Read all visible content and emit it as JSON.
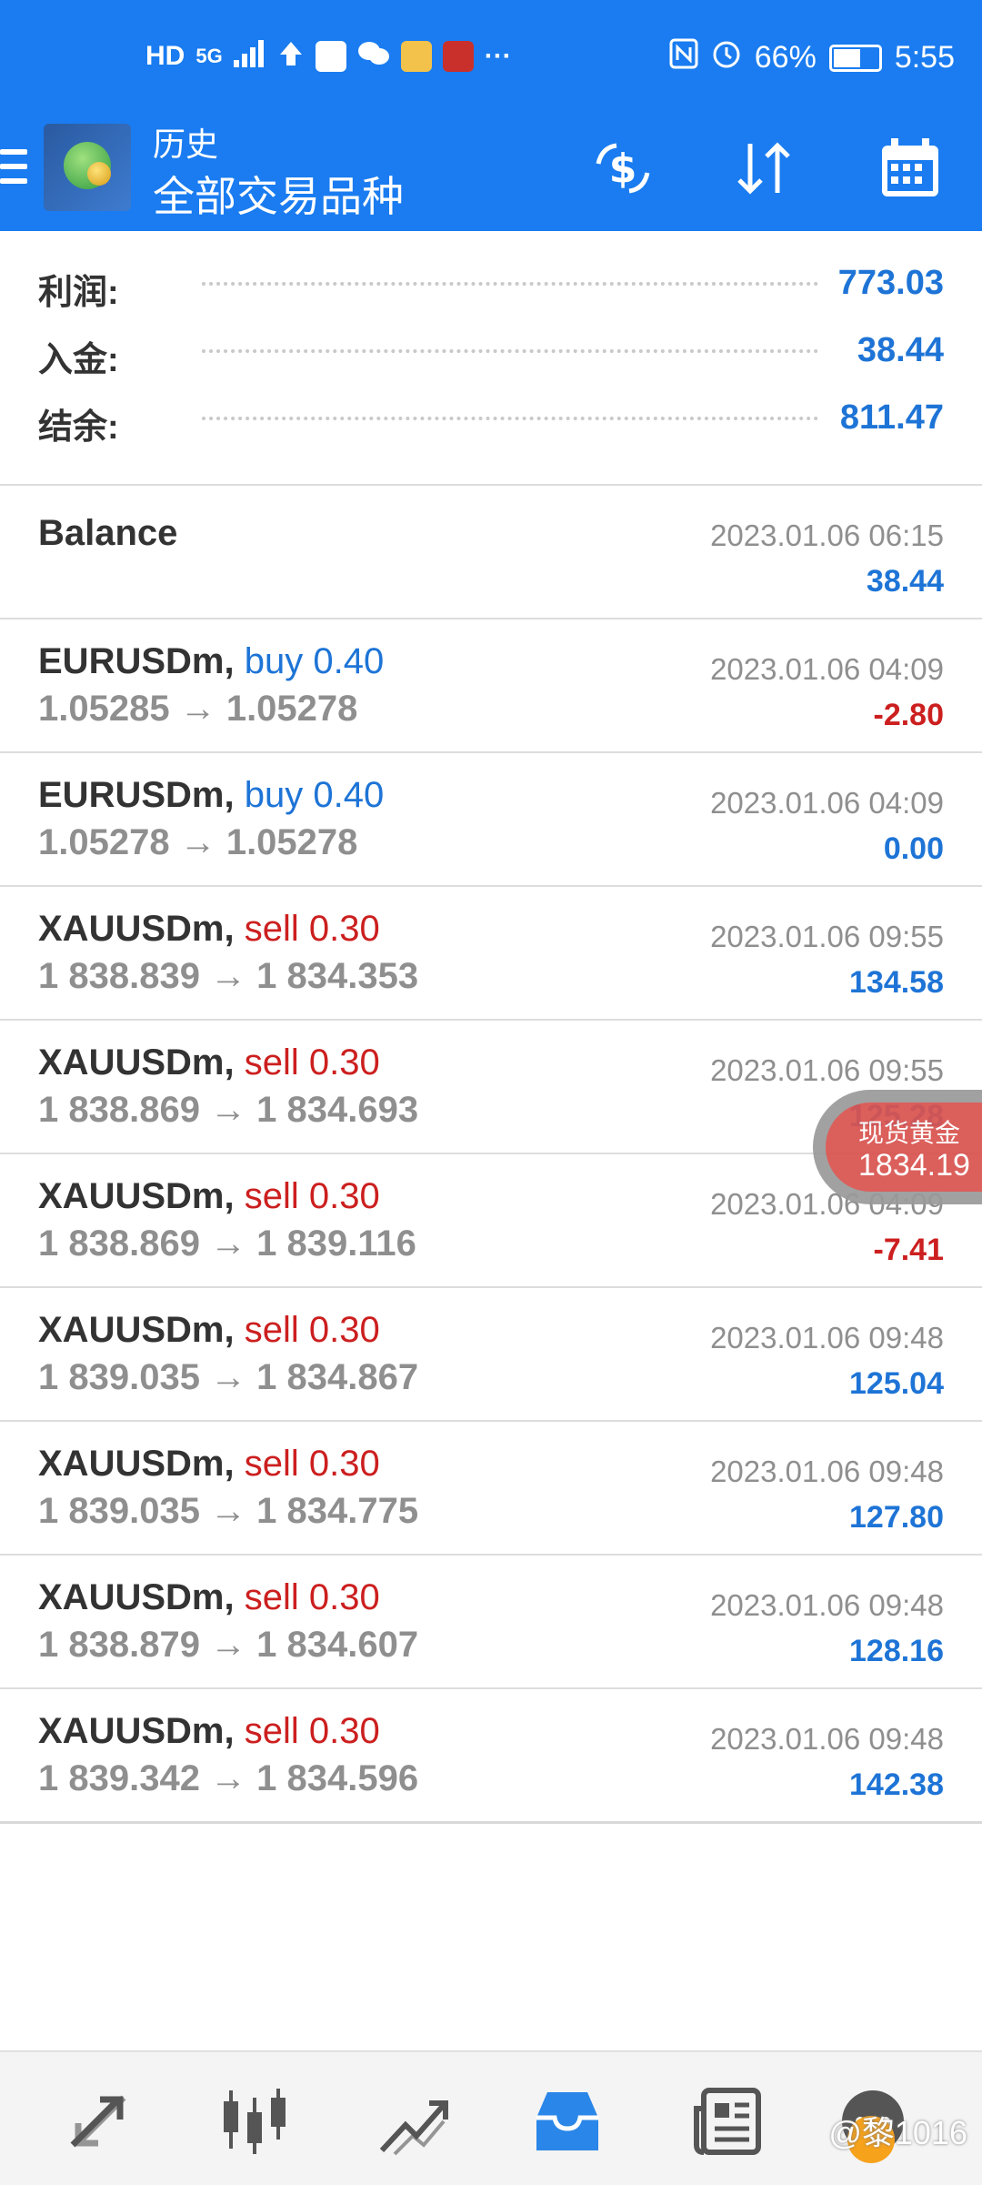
{
  "status_bar": {
    "left_icons": [
      "HD",
      "5G",
      "signal-icon",
      "upload-icon",
      "gallery-icon",
      "wechat-icon",
      "weibo-icon",
      "app-icon",
      "more-icon"
    ],
    "hd_label": "HD",
    "net_label": "5G",
    "more_label": "···",
    "battery": "66%",
    "battery_level": 0.66,
    "time": "5:55"
  },
  "appbar": {
    "title_small": "历史",
    "title_big": "全部交易品种",
    "icons": [
      "menu-icon",
      "app-logo",
      "currency-exchange-icon",
      "sort-icon",
      "calendar-icon"
    ]
  },
  "summary": [
    {
      "label": "利润:",
      "value": "773.03"
    },
    {
      "label": "入金:",
      "value": "38.44"
    },
    {
      "label": "结余:",
      "value": "811.47"
    }
  ],
  "history": [
    {
      "symbol": "Balance",
      "side": "",
      "volume": "",
      "prices": "",
      "time": "2023.01.06 06:15",
      "profit": "38.44",
      "profit_color": "#1e74d6"
    },
    {
      "symbol": "EURUSDm,",
      "side": "buy",
      "volume": "0.40",
      "prices": "1.05285 → 1.05278",
      "time": "2023.01.06 04:09",
      "profit": "-2.80",
      "profit_color": "#cc1f1f"
    },
    {
      "symbol": "EURUSDm,",
      "side": "buy",
      "volume": "0.40",
      "prices": "1.05278 → 1.05278",
      "time": "2023.01.06 04:09",
      "profit": "0.00",
      "profit_color": "#1e74d6"
    },
    {
      "symbol": "XAUUSDm,",
      "side": "sell",
      "volume": "0.30",
      "prices": "1 838.839 → 1 834.353",
      "time": "2023.01.06 09:55",
      "profit": "134.58",
      "profit_color": "#1e74d6"
    },
    {
      "symbol": "XAUUSDm,",
      "side": "sell",
      "volume": "0.30",
      "prices": "1 838.869 → 1 834.693",
      "time": "2023.01.06 09:55",
      "profit": "125.28",
      "profit_color": "#1e74d6"
    },
    {
      "symbol": "XAUUSDm,",
      "side": "sell",
      "volume": "0.30",
      "prices": "1 838.869 → 1 839.116",
      "time": "2023.01.06 04:09",
      "profit": "-7.41",
      "profit_color": "#cc1f1f"
    },
    {
      "symbol": "XAUUSDm,",
      "side": "sell",
      "volume": "0.30",
      "prices": "1 839.035 → 1 834.867",
      "time": "2023.01.06 09:48",
      "profit": "125.04",
      "profit_color": "#1e74d6"
    },
    {
      "symbol": "XAUUSDm,",
      "side": "sell",
      "volume": "0.30",
      "prices": "1 839.035 → 1 834.775",
      "time": "2023.01.06 09:48",
      "profit": "127.80",
      "profit_color": "#1e74d6"
    },
    {
      "symbol": "XAUUSDm,",
      "side": "sell",
      "volume": "0.30",
      "prices": "1 838.879 → 1 834.607",
      "time": "2023.01.06 09:48",
      "profit": "128.16",
      "profit_color": "#1e74d6"
    },
    {
      "symbol": "XAUUSDm,",
      "side": "sell",
      "volume": "0.30",
      "prices": "1 839.342 → 1 834.596",
      "time": "2023.01.06 09:48",
      "profit": "142.38",
      "profit_color": "#1e74d6"
    }
  ],
  "floating_badge": {
    "name": "现货黄金",
    "value": "1834.19"
  },
  "bottom_nav": {
    "items": [
      "quotes-icon",
      "chart-icon",
      "trade-icon",
      "history-icon",
      "news-icon",
      "messages-icon"
    ],
    "active": "history-icon"
  },
  "watermark": "@黎1016",
  "colors": {
    "accent": "#1a7cf0",
    "positive": "#1e74d6",
    "negative": "#cc1f1f"
  }
}
